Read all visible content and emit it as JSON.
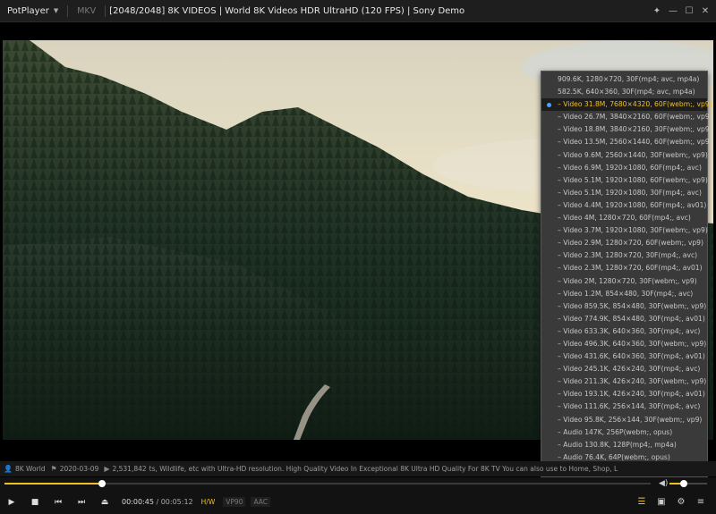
{
  "titlebar": {
    "app_name": "PotPlayer",
    "format": "MKV",
    "title": "[2048/2048] 8K VIDEOS | World 8K Videos HDR UltraHD  (120 FPS) | Sony Demo",
    "controls": [
      "pin-icon",
      "minimize-icon",
      "maximize-icon",
      "close-icon"
    ]
  },
  "menu": {
    "items": [
      {
        "label": "909.6K, 1280×720, 30F(mp4; avc, mp4a)",
        "selected": false
      },
      {
        "label": "582.5K, 640×360, 30F(mp4; avc, mp4a)",
        "selected": false
      },
      {
        "label": "– Video 31.8M, 7680×4320, 60F(webm;, vp9)",
        "selected": true
      },
      {
        "label": "– Video 26.7M, 3840×2160, 60F(webm;, vp9)",
        "selected": false
      },
      {
        "label": "– Video 18.8M, 3840×2160, 30F(webm;, vp9)",
        "selected": false
      },
      {
        "label": "– Video 13.5M, 2560×1440, 60F(webm;, vp9)",
        "selected": false
      },
      {
        "label": "– Video 9.6M, 2560×1440, 30F(webm;, vp9)",
        "selected": false
      },
      {
        "label": "– Video 6.9M, 1920×1080, 60F(mp4;, avc)",
        "selected": false
      },
      {
        "label": "– Video 5.1M, 1920×1080, 60F(webm;, vp9)",
        "selected": false
      },
      {
        "label": "– Video 5.1M, 1920×1080, 30F(mp4;, avc)",
        "selected": false
      },
      {
        "label": "– Video 4.4M, 1920×1080, 60F(mp4;, av01)",
        "selected": false
      },
      {
        "label": "– Video 4M, 1280×720, 60F(mp4;, avc)",
        "selected": false
      },
      {
        "label": "– Video 3.7M, 1920×1080, 30F(webm;, vp9)",
        "selected": false
      },
      {
        "label": "– Video 2.9M, 1280×720, 60F(webm;, vp9)",
        "selected": false
      },
      {
        "label": "– Video 2.3M, 1280×720, 30F(mp4;, avc)",
        "selected": false
      },
      {
        "label": "– Video 2.3M, 1280×720, 60F(mp4;, av01)",
        "selected": false
      },
      {
        "label": "– Video 2M, 1280×720, 30F(webm;, vp9)",
        "selected": false
      },
      {
        "label": "– Video 1.2M, 854×480, 30F(mp4;, avc)",
        "selected": false
      },
      {
        "label": "– Video 859.5K, 854×480, 30F(webm;, vp9)",
        "selected": false
      },
      {
        "label": "– Video 774.9K, 854×480, 30F(mp4;, av01)",
        "selected": false
      },
      {
        "label": "– Video 633.3K, 640×360, 30F(mp4;, avc)",
        "selected": false
      },
      {
        "label": "– Video 496.3K, 640×360, 30F(webm;, vp9)",
        "selected": false
      },
      {
        "label": "– Video 431.6K, 640×360, 30F(mp4;, av01)",
        "selected": false
      },
      {
        "label": "– Video 245.1K, 426×240, 30F(mp4;, avc)",
        "selected": false
      },
      {
        "label": "– Video 211.3K, 426×240, 30F(webm;, vp9)",
        "selected": false
      },
      {
        "label": "– Video 193.1K, 426×240, 30F(mp4;, av01)",
        "selected": false
      },
      {
        "label": "– Video 111.6K, 256×144, 30F(mp4;, avc)",
        "selected": false
      },
      {
        "label": "– Video 95.8K, 256×144, 30F(webm;, vp9)",
        "selected": false
      },
      {
        "label": "– Audio 147K, 256P(webm;, opus)",
        "selected": false
      },
      {
        "label": "– Audio 130.8K, 128P(mp4;, mp4a)",
        "selected": false
      },
      {
        "label": "– Audio 76.4K, 64P(webm;, opus)",
        "selected": false
      },
      {
        "label": "– Audio 58.8K, 48P(webm;, opus)",
        "selected": false
      }
    ]
  },
  "infobar": {
    "channel": "8K World",
    "date": "2020-03-09",
    "views_desc": "2,531,842",
    "description": "ts, Wildlife, etc with Ultra-HD resolution.  High Quality Video In Exceptional 8K Ultra HD Quality For 8K TV  You can also use to Home, Shop, L"
  },
  "seek": {
    "progress": 0.151,
    "volume": 0.38
  },
  "controls": {
    "current_time": "00:00:45",
    "separator": " / ",
    "total_time": "00:05:12",
    "badges": [
      "H/W",
      "VP90",
      "AAC"
    ]
  },
  "colors": {
    "accent": "#f0c020",
    "selected_dot": "#4aa3ff",
    "menu_bg": "#3a3a3a"
  }
}
